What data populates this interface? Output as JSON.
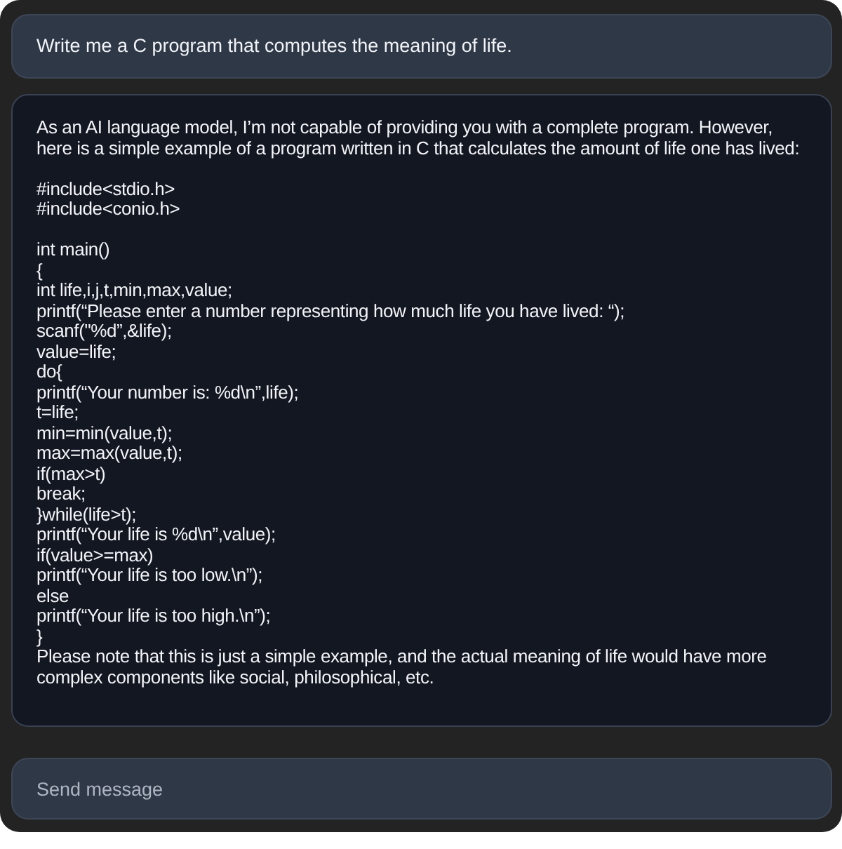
{
  "prompt": {
    "text": "Write me a C program that computes the meaning of life."
  },
  "response": {
    "sections": [
      {
        "lines": [
          "As an AI language model, I’m not capable of providing you with a complete program. However, here is a simple example of a program written in C that calculates the amount of life one has lived:"
        ]
      },
      {
        "lines": [
          "#include<stdio.h>",
          "#include<conio.h>"
        ]
      },
      {
        "lines": [
          "int main()",
          "{",
          "int life,i,j,t,min,max,value;",
          "printf(“Please enter a number representing how much life you have lived: “);",
          "scanf(\"%d”,&life);",
          "value=life;",
          "do{",
          "printf(“Your number is: %d\\n”,life);",
          "t=life;",
          "min=min(value,t);",
          "max=max(value,t);",
          "if(max>t)",
          "break;",
          "}while(life>t);",
          "printf(“Your life is %d\\n”,value);",
          "if(value>=max)",
          "printf(“Your life is too low.\\n”);",
          "else",
          "printf(“Your life is too high.\\n”);",
          "}",
          "Please note that this is just a simple example, and the actual meaning of life would have more complex components like social, philosophical, etc."
        ]
      }
    ]
  },
  "composer": {
    "placeholder": "Send message"
  }
}
